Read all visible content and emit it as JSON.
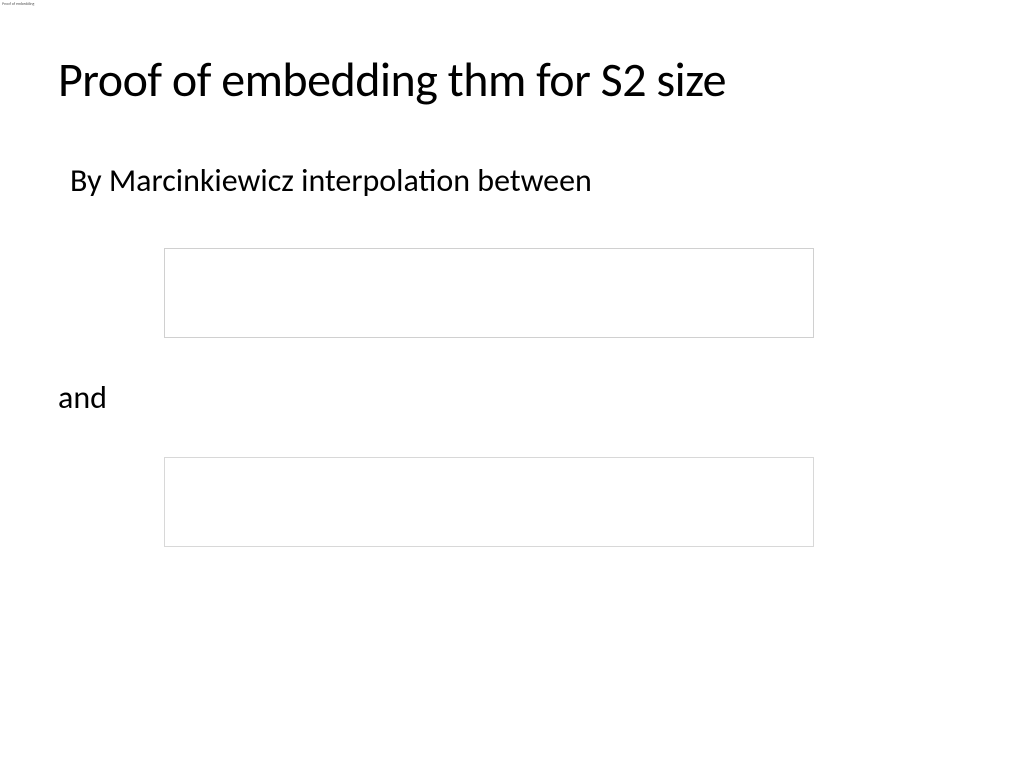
{
  "topLabel": "Proof of embedding",
  "title": "Proof of embedding thm for S2 size",
  "line1": "By Marcinkiewicz interpolation between",
  "lineAnd": "and"
}
